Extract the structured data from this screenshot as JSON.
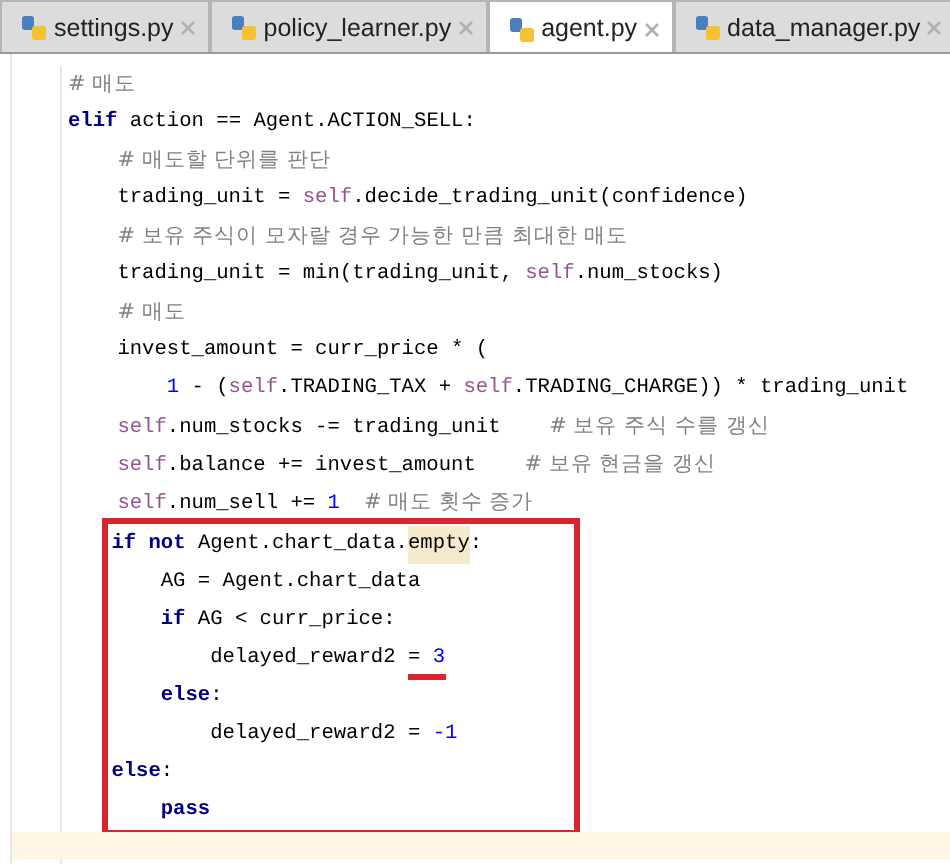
{
  "tabs": [
    {
      "label": "settings.py",
      "selected": false
    },
    {
      "label": "policy_learner.py",
      "selected": false
    },
    {
      "label": "agent.py",
      "selected": true
    },
    {
      "label": "data_manager.py",
      "selected": false
    }
  ],
  "lines": [
    {
      "boxed": false,
      "current": false,
      "tokens": [
        {
          "text": "# 매도",
          "kind": "comment"
        }
      ]
    },
    {
      "boxed": false,
      "current": false,
      "tokens": [
        {
          "text": "elif",
          "kind": "keyword"
        },
        {
          "text": " action == Agent.ACTION_SELL:",
          "kind": "plain"
        }
      ],
      "children": [
        {
          "boxed": false,
          "current": false,
          "tokens": [
            {
              "text": "# 매도할 단위를 판단",
              "kind": "comment"
            }
          ]
        },
        {
          "boxed": false,
          "current": false,
          "tokens": [
            {
              "text": "trading_unit = ",
              "kind": "plain"
            },
            {
              "text": "self",
              "kind": "self"
            },
            {
              "text": ".decide_trading_unit(confidence)",
              "kind": "plain"
            }
          ]
        },
        {
          "boxed": false,
          "current": false,
          "tokens": [
            {
              "text": "# 보유 주식이 모자랄 경우 가능한 만큼 최대한 매도",
              "kind": "comment"
            }
          ]
        },
        {
          "boxed": false,
          "current": false,
          "tokens": [
            {
              "text": "trading_unit = min(trading_unit, ",
              "kind": "plain"
            },
            {
              "text": "self",
              "kind": "self"
            },
            {
              "text": ".num_stocks)",
              "kind": "plain"
            }
          ]
        },
        {
          "boxed": false,
          "current": false,
          "tokens": [
            {
              "text": "# 매도",
              "kind": "comment"
            }
          ]
        },
        {
          "boxed": false,
          "current": false,
          "tokens": [
            {
              "text": "invest_amount = curr_price * (",
              "kind": "plain"
            }
          ],
          "children": [
            {
              "boxed": false,
              "current": false,
              "tokens": [
                {
                  "text": "1",
                  "kind": "number"
                },
                {
                  "text": " - (",
                  "kind": "plain"
                },
                {
                  "text": "self",
                  "kind": "self"
                },
                {
                  "text": ".TRADING_TAX + ",
                  "kind": "plain"
                },
                {
                  "text": "self",
                  "kind": "self"
                },
                {
                  "text": ".TRADING_CHARGE)) * trading_unit",
                  "kind": "plain"
                }
              ]
            }
          ]
        },
        {
          "boxed": false,
          "current": false,
          "tokens": [
            {
              "text": "self",
              "kind": "self"
            },
            {
              "text": ".num_stocks -= trading_unit  ",
              "kind": "plain"
            },
            {
              "text": "# 보유 주식 수를 갱신",
              "kind": "comment"
            }
          ]
        },
        {
          "boxed": false,
          "current": false,
          "tokens": [
            {
              "text": "self",
              "kind": "self"
            },
            {
              "text": ".balance += invest_amount  ",
              "kind": "plain"
            },
            {
              "text": "# 보유 현금을 갱신",
              "kind": "comment"
            }
          ]
        },
        {
          "boxed": false,
          "current": false,
          "tokens": [
            {
              "text": "self",
              "kind": "self"
            },
            {
              "text": ".num_sell += ",
              "kind": "plain"
            },
            {
              "text": "1",
              "kind": "number"
            },
            {
              "text": "# 매도 횟수 증가",
              "kind": "comment"
            }
          ]
        },
        {
          "boxed": true,
          "current": false,
          "tokens": [
            {
              "text": "if not",
              "kind": "keyword"
            },
            {
              "text": " Agent.chart_data.",
              "kind": "plain"
            },
            {
              "text": "empty",
              "kind": "highlight"
            },
            {
              "text": ":",
              "kind": "plain"
            }
          ],
          "children": [
            {
              "boxed": true,
              "current": false,
              "tokens": [
                {
                  "text": "AG = Agent.chart_data",
                  "kind": "plain"
                }
              ]
            },
            {
              "boxed": true,
              "current": false,
              "tokens": [
                {
                  "text": "if",
                  "kind": "keyword"
                },
                {
                  "text": " AG < curr_price:",
                  "kind": "plain"
                }
              ],
              "children": [
                {
                  "boxed": true,
                  "current": false,
                  "tokens": [
                    {
                      "text": "delayed_reward2 ",
                      "kind": "plain"
                    },
                    {
                      "text": "= ",
                      "kind": "plain",
                      "underlined": true
                    },
                    {
                      "text": "3",
                      "kind": "number",
                      "underlined": true
                    }
                  ]
                }
              ]
            },
            {
              "boxed": true,
              "current": false,
              "tokens": [
                {
                  "text": "else",
                  "kind": "keyword"
                },
                {
                  "text": ":",
                  "kind": "plain"
                }
              ],
              "children": [
                {
                  "boxed": true,
                  "current": false,
                  "tokens": [
                    {
                      "text": "delayed_reward2 = ",
                      "kind": "plain"
                    },
                    {
                      "text": "-1",
                      "kind": "number"
                    }
                  ]
                }
              ]
            }
          ]
        },
        {
          "boxed": true,
          "current": false,
          "tokens": [
            {
              "text": "else",
              "kind": "keyword"
            },
            {
              "text": ":",
              "kind": "plain"
            }
          ],
          "children": [
            {
              "boxed": true,
              "current": false,
              "tokens": [
                {
                  "text": "pass",
                  "kind": "keyword"
                }
              ]
            }
          ]
        }
      ]
    },
    {
      "boxed": false,
      "current": true
    }
  ]
}
